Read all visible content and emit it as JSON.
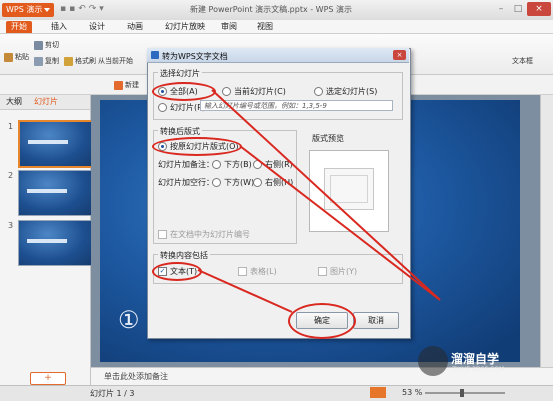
{
  "app": {
    "badge": "WPS 演示",
    "title": "新建 PowerPoint 演示文稿.pptx - WPS 演示"
  },
  "ribbon_tabs": [
    "开始",
    "插入",
    "设计",
    "动画",
    "幻灯片放映",
    "审阅",
    "视图"
  ],
  "ribbon": {
    "paste": "粘贴",
    "cut": "剪切",
    "copy": "复制",
    "format_painter": "格式刷",
    "from_current": "从当前开始",
    "new": "新建",
    "textbox": "文本框"
  },
  "left_panel": {
    "tabs": [
      "大纲",
      "幻灯片"
    ],
    "slide_numbers": [
      "1",
      "2",
      "3"
    ],
    "add_button": "+"
  },
  "slide": {
    "number_glyph": "①"
  },
  "notes_placeholder": "单击此处添加备注",
  "status": {
    "slide_info": "幻灯片 1 / 3",
    "zoom": "53 %"
  },
  "dialog": {
    "title": "转为WPS文字文档",
    "close": "×",
    "select_group": "选择幻灯片",
    "opt_all": "全部(A)",
    "opt_current": "当前幻灯片(C)",
    "opt_selected": "选定幻灯片(S)",
    "opt_slides": "幻灯片(P):",
    "range_hint": "输入幻灯片编号或范围，例如：1,3,5-9",
    "layout_group": "转换后版式",
    "opt_original": "按原幻灯片版式(O)",
    "notes_label": "幻灯片加备注：",
    "blank_label": "幻灯片加空行：",
    "below_b": "下方(B)",
    "right_r": "右侧(R)",
    "below_w": "下方(W)",
    "right_h": "右侧(H)",
    "preview_label": "版式预览",
    "number_caption": "在文档中为幻灯片编号",
    "content_group": "转换内容包括",
    "chk_text": "文本(T)",
    "chk_table": "表格(L)",
    "chk_image": "图片(Y)",
    "ok": "确定",
    "cancel": "取消"
  },
  "watermark": {
    "name": "溜溜自学",
    "sub": "ZIXUE.3D66.COM"
  },
  "colors": {
    "accent": "#e25a1c",
    "annotation": "#d9281f"
  }
}
